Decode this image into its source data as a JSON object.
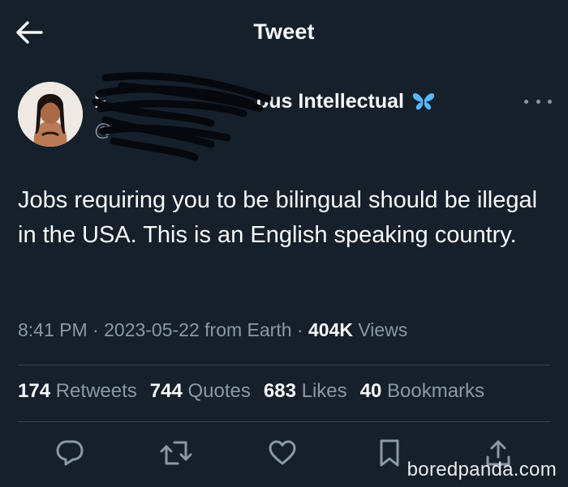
{
  "header": {
    "title": "Tweet"
  },
  "author": {
    "name_prefix": "F",
    "name_visible": "ous Intellectual",
    "badge_icon": "butterfly-icon",
    "handle": "@"
  },
  "tweet": {
    "text": "Jobs requiring you to be bilingual should be illegal in the USA. This is an English speaking country."
  },
  "meta": {
    "time": "8:41 PM",
    "date": "2023-05-22",
    "source": "from Earth",
    "views_count": "404K",
    "views_label": "Views"
  },
  "stats": [
    {
      "count": "174",
      "label": "Retweets"
    },
    {
      "count": "744",
      "label": "Quotes"
    },
    {
      "count": "683",
      "label": "Likes"
    },
    {
      "count": "40",
      "label": "Bookmarks"
    }
  ],
  "actions": [
    "reply-icon",
    "retweet-icon",
    "like-icon",
    "bookmark-icon",
    "share-icon"
  ],
  "watermark": "boredpanda.com",
  "colors": {
    "background": "#15202b",
    "text": "#f7f9f9",
    "muted": "#8b98a5",
    "divider": "#38444d",
    "badge": "#58b7ff"
  }
}
